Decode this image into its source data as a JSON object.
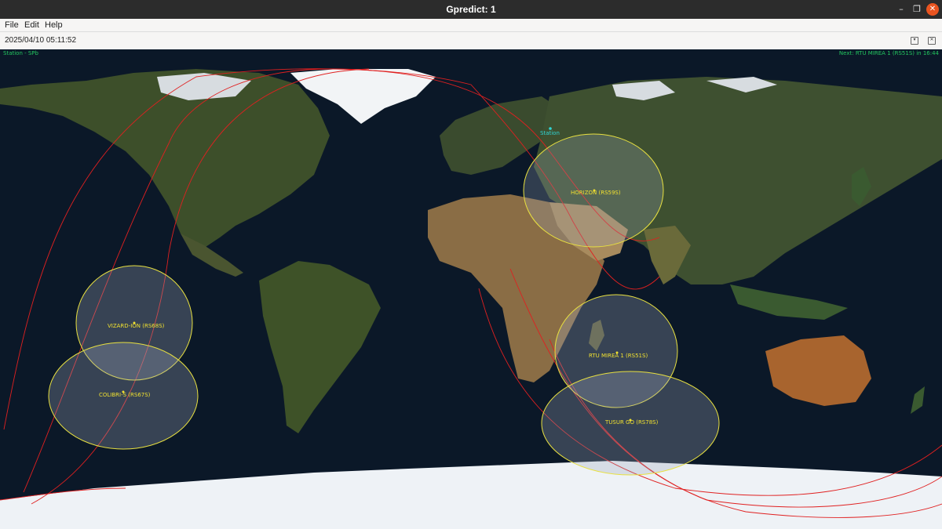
{
  "window": {
    "title": "Gpredict: 1"
  },
  "menu": {
    "items": [
      "File",
      "Edit",
      "Help"
    ]
  },
  "toolbar": {
    "datetime": "2025/04/10 05:11:52"
  },
  "map": {
    "station_label": "Station - SPb",
    "next_pass": "Next: RTU MIREA 1 (RS51S) in 16:44",
    "station_marker": "Station",
    "satellites": [
      "HORIZON (RS59S)",
      "VIZARD-ION (RS68S)",
      "COLIBRI-S (RS67S)",
      "RTU MIREA 1 (RS51S)",
      "TUSUR GO (RS78S)"
    ]
  },
  "colors": {
    "station": "#2fd5d5",
    "satellite": "#f0e030",
    "status": "#22c55e",
    "track": "#e02020",
    "close_button": "#e95420"
  },
  "icons": [
    "minimize-icon",
    "restore-icon",
    "close-icon",
    "dropdown-icon",
    "detach-icon"
  ]
}
